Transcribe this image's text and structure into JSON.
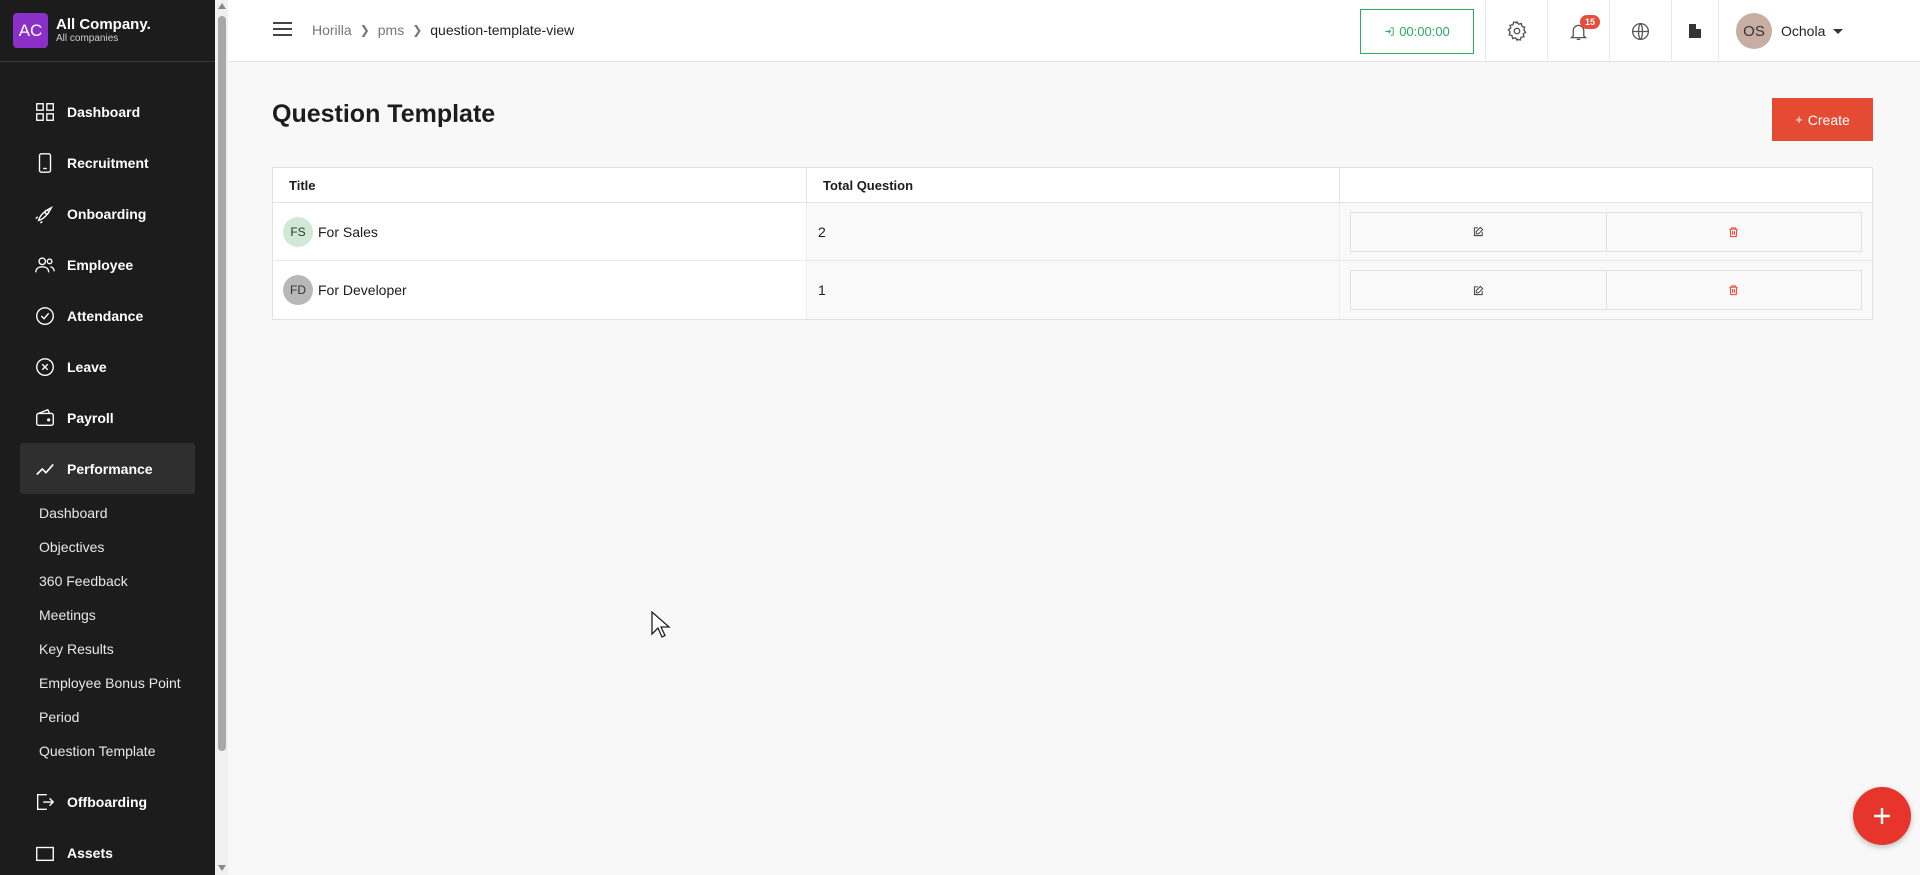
{
  "company": {
    "initials": "AC",
    "name": "All Company.",
    "subtitle": "All companies"
  },
  "sidebar": {
    "items": [
      {
        "label": "Dashboard",
        "icon": "grid-icon"
      },
      {
        "label": "Recruitment",
        "icon": "phone-icon"
      },
      {
        "label": "Onboarding",
        "icon": "rocket-icon"
      },
      {
        "label": "Employee",
        "icon": "people-icon"
      },
      {
        "label": "Attendance",
        "icon": "check-circle-icon"
      },
      {
        "label": "Leave",
        "icon": "x-circle-icon"
      },
      {
        "label": "Payroll",
        "icon": "wallet-icon"
      },
      {
        "label": "Performance",
        "icon": "trend-icon"
      }
    ],
    "submenu": [
      "Dashboard",
      "Objectives",
      "360 Feedback",
      "Meetings",
      "Key Results",
      "Employee Bonus Point",
      "Period",
      "Question Template"
    ],
    "after": [
      {
        "label": "Offboarding",
        "icon": "exit-icon"
      },
      {
        "label": "Assets",
        "icon": "laptop-icon"
      }
    ]
  },
  "breadcrumb": {
    "items": [
      "Horilla",
      "pms"
    ],
    "current": "question-template-view"
  },
  "topbar": {
    "timer": "00:00:00",
    "notifications": "15",
    "user_initials": "OS",
    "user_name": "Ochola"
  },
  "page": {
    "title": "Question Template",
    "create_label": "Create"
  },
  "table": {
    "headers": [
      "Title",
      "Total Question"
    ],
    "rows": [
      {
        "initials": "FS",
        "title": "For Sales",
        "total": "2"
      },
      {
        "initials": "FD",
        "title": "For Developer",
        "total": "1"
      }
    ]
  },
  "colors": {
    "accent": "#e54b33",
    "sidebar": "#1c1c1c",
    "timer": "#27ae60",
    "badge": "#e74c3c"
  }
}
